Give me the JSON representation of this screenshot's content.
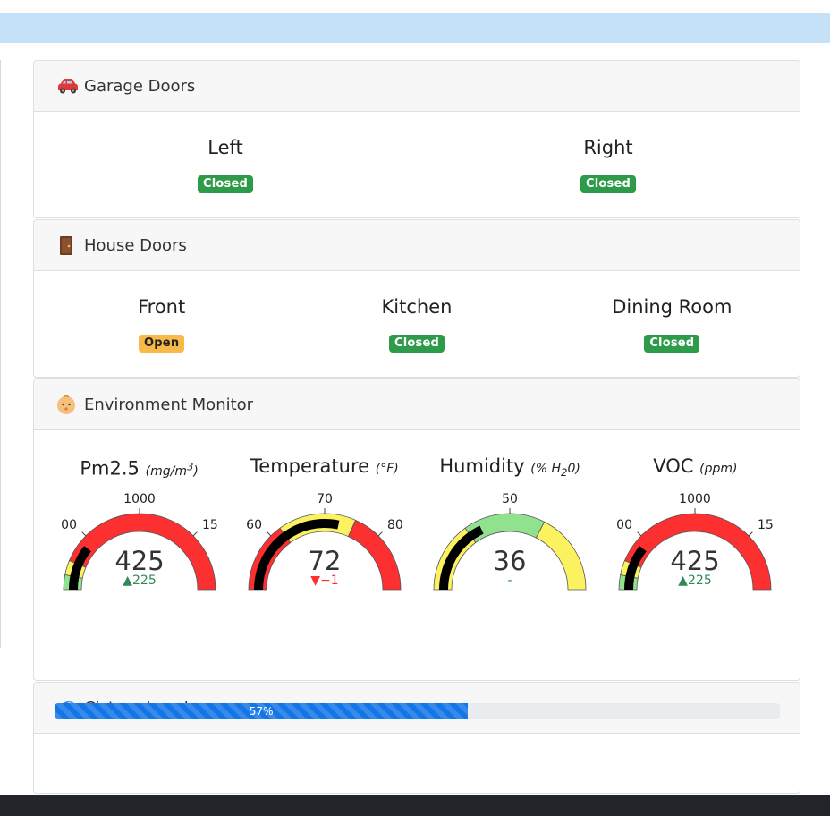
{
  "colors": {
    "closed": "#2d9b4a",
    "open": "#f6b94a",
    "green": "#90e28f",
    "yellow": "#fcf25f",
    "red": "#fc3031",
    "progress": "#1476e6"
  },
  "garage": {
    "icon": "car-icon",
    "title": "Garage Doors",
    "doors": [
      {
        "name": "Left",
        "status": "Closed"
      },
      {
        "name": "Right",
        "status": "Closed"
      }
    ]
  },
  "house": {
    "icon": "door-icon",
    "title": "House Doors",
    "doors": [
      {
        "name": "Front",
        "status": "Open"
      },
      {
        "name": "Kitchen",
        "status": "Closed"
      },
      {
        "name": "Dining Room",
        "status": "Closed"
      }
    ]
  },
  "environment": {
    "icon": "baby-face-icon",
    "title": "Environment Monitor",
    "gauges": [
      {
        "name": "Pm2.5",
        "unit_prefix": "(mg/m",
        "unit_sup": "3",
        "unit_suffix": ")",
        "value": "425",
        "delta_arrow": "▲",
        "delta": "225",
        "delta_color": "#2e8b57",
        "labels": [
          "00",
          "1000",
          "15"
        ],
        "min": 0,
        "max": 2000,
        "needle": 425,
        "bands": [
          [
            0,
            125,
            "#90e28f"
          ],
          [
            125,
            250,
            "#fcf25f"
          ],
          [
            250,
            2000,
            "#fc3031"
          ]
        ]
      },
      {
        "name": "Temperature",
        "unit_prefix": "(°F)",
        "unit_sup": "",
        "unit_suffix": "",
        "value": "72",
        "delta_arrow": "▼",
        "delta": "−1",
        "delta_color": "#fc3031",
        "labels": [
          "60",
          "70",
          "80"
        ],
        "min": 55,
        "max": 85,
        "needle": 72,
        "bands": [
          [
            55,
            64,
            "#fc3031"
          ],
          [
            64,
            74,
            "#fcf25f"
          ],
          [
            74,
            85,
            "#fc3031"
          ]
        ]
      },
      {
        "name": "Humidity",
        "unit_prefix": "(% H",
        "unit_sub": "2",
        "unit_suffix": "0)",
        "value": "36",
        "delta_arrow": "",
        "delta": "-",
        "delta_color": "#2e8b57",
        "labels": [
          "50"
        ],
        "min": 0,
        "max": 100,
        "needle": 36,
        "bands": [
          [
            0,
            30,
            "#fcf25f"
          ],
          [
            30,
            65,
            "#90e28f"
          ],
          [
            65,
            100,
            "#fcf25f"
          ]
        ]
      },
      {
        "name": "VOC",
        "unit_prefix": "(ppm)",
        "unit_sup": "",
        "unit_suffix": "",
        "value": "425",
        "delta_arrow": "▲",
        "delta": "225",
        "delta_color": "#2e8b57",
        "labels": [
          "00",
          "1000",
          "15"
        ],
        "min": 0,
        "max": 2000,
        "needle": 425,
        "bands": [
          [
            0,
            125,
            "#90e28f"
          ],
          [
            125,
            250,
            "#fcf25f"
          ],
          [
            250,
            2000,
            "#fc3031"
          ]
        ]
      }
    ]
  },
  "cistern": {
    "icon": "water-wave-icon",
    "title": "Cistern Level",
    "level": 0.57,
    "label": "57%"
  }
}
